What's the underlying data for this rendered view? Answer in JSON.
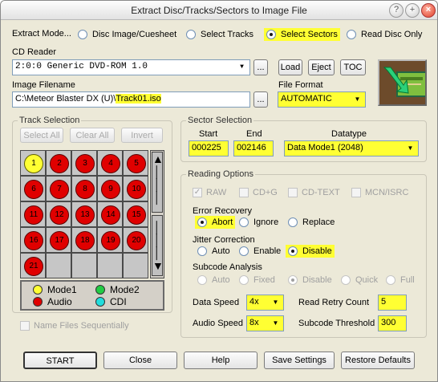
{
  "window": {
    "title": "Extract Disc/Tracks/Sectors to Image File"
  },
  "extract_mode": {
    "label": "Extract Mode...",
    "options": [
      "Disc Image/Cuesheet",
      "Select Tracks",
      "Select Sectors",
      "Read Disc Only"
    ],
    "selected": "Select Sectors"
  },
  "cd_reader": {
    "label": "CD Reader",
    "value": "2:0:0 Generic  DVD-ROM           1.0",
    "browse": "...",
    "load": "Load",
    "eject": "Eject",
    "toc": "TOC"
  },
  "image_filename": {
    "label": "Image Filename",
    "value_prefix": "C:\\Meteor Blaster DX (U)\\",
    "value_file": "Track01.iso",
    "browse": "..."
  },
  "file_format": {
    "label": "File Format",
    "value": "AUTOMATIC"
  },
  "track_selection": {
    "label": "Track Selection",
    "select_all": "Select All",
    "clear_all": "Clear All",
    "invert": "Invert",
    "tracks": [
      "1",
      "2",
      "3",
      "4",
      "5",
      "6",
      "7",
      "8",
      "9",
      "10",
      "11",
      "12",
      "13",
      "14",
      "15",
      "16",
      "17",
      "18",
      "19",
      "20",
      "21"
    ],
    "legend": {
      "mode1": "Mode1",
      "mode2": "Mode2",
      "audio": "Audio",
      "cdi": "CDI",
      "mode1_color": "#ffff33",
      "mode2_color": "#22cc44",
      "audio_color": "#e00000",
      "cdi_color": "#22dddd"
    },
    "name_files_seq": "Name Files Sequentially"
  },
  "sector_selection": {
    "label": "Sector Selection",
    "start_label": "Start",
    "end_label": "End",
    "datatype_label": "Datatype",
    "start": "000225",
    "end": "002146",
    "datatype": "Data  Mode1 (2048)"
  },
  "reading_options": {
    "label": "Reading Options",
    "raw": "RAW",
    "cdg": "CD+G",
    "cdtext": "CD-TEXT",
    "mcn": "MCN/ISRC",
    "error_recovery": {
      "label": "Error Recovery",
      "abort": "Abort",
      "ignore": "Ignore",
      "replace": "Replace"
    },
    "jitter": {
      "label": "Jitter Correction",
      "auto": "Auto",
      "enable": "Enable",
      "disable": "Disable"
    },
    "subcode": {
      "label": "Subcode Analysis",
      "auto": "Auto",
      "fixed": "Fixed",
      "disable": "Disable",
      "quick": "Quick",
      "full": "Full"
    },
    "data_speed_label": "Data Speed",
    "data_speed": "4x",
    "audio_speed_label": "Audio Speed",
    "audio_speed": "8x",
    "retry_label": "Read Retry Count",
    "retry": "5",
    "subcode_threshold_label": "Subcode Threshold",
    "subcode_threshold": "300"
  },
  "buttons": {
    "start": "START",
    "close": "Close",
    "help": "Help",
    "save": "Save Settings",
    "restore": "Restore Defaults"
  }
}
